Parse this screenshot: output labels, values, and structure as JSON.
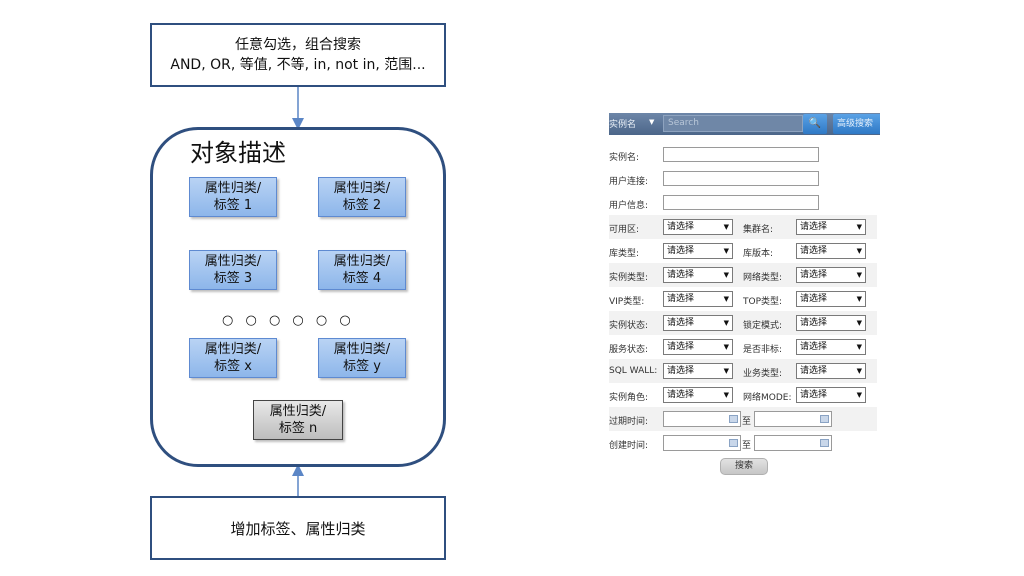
{
  "diagram": {
    "top_box": {
      "line1": "任意勾选，组合搜索",
      "line2": "AND, OR, 等值, 不等, in, not in, 范围..."
    },
    "object_title": "对象描述",
    "tags": [
      {
        "line1": "属性归类/",
        "line2": "标签 1"
      },
      {
        "line1": "属性归类/",
        "line2": "标签 2"
      },
      {
        "line1": "属性归类/",
        "line2": "标签 3"
      },
      {
        "line1": "属性归类/",
        "line2": "标签 4"
      },
      {
        "line1": "属性归类/",
        "line2": "标签 x"
      },
      {
        "line1": "属性归类/",
        "line2": "标签 y"
      },
      {
        "line1": "属性归类/",
        "line2": "标签 n"
      }
    ],
    "ellipsis": "○ ○ ○  ○ ○ ○",
    "bottom_box": "增加标签、属性归类"
  },
  "form": {
    "search_bar": {
      "instance_label": "实例名",
      "caret": "▼",
      "placeholder": "Search",
      "search_icon": "🔍",
      "advanced_label": "高级搜索"
    },
    "text_rows": [
      {
        "label": "实例名:"
      },
      {
        "label": "用户连接:"
      },
      {
        "label": "用户信息:"
      }
    ],
    "select_rows": [
      {
        "left_label": "可用区:",
        "left_value": "请选择",
        "right_label": "集群名:",
        "right_value": "请选择"
      },
      {
        "left_label": "库类型:",
        "left_value": "请选择",
        "right_label": "库版本:",
        "right_value": "请选择"
      },
      {
        "left_label": "实例类型:",
        "left_value": "请选择",
        "right_label": "网络类型:",
        "right_value": "请选择"
      },
      {
        "left_label": "VIP类型:",
        "left_value": "请选择",
        "right_label": "TOP类型:",
        "right_value": "请选择"
      },
      {
        "left_label": "实例状态:",
        "left_value": "请选择",
        "right_label": "锁定模式:",
        "right_value": "请选择"
      },
      {
        "left_label": "服务状态:",
        "left_value": "请选择",
        "right_label": "是否非标:",
        "right_value": "请选择"
      },
      {
        "left_label": "SQL WALL:",
        "left_value": "请选择",
        "right_label": "业务类型:",
        "right_value": "请选择"
      },
      {
        "left_label": "实例角色:",
        "left_value": "请选择",
        "right_label": "网络MODE:",
        "right_value": "请选择"
      }
    ],
    "date_rows": [
      {
        "label": "过期时间:",
        "to": "至"
      },
      {
        "label": "创建时间:",
        "to": "至"
      }
    ],
    "search_button": "搜索",
    "select_arrow": "▼"
  }
}
